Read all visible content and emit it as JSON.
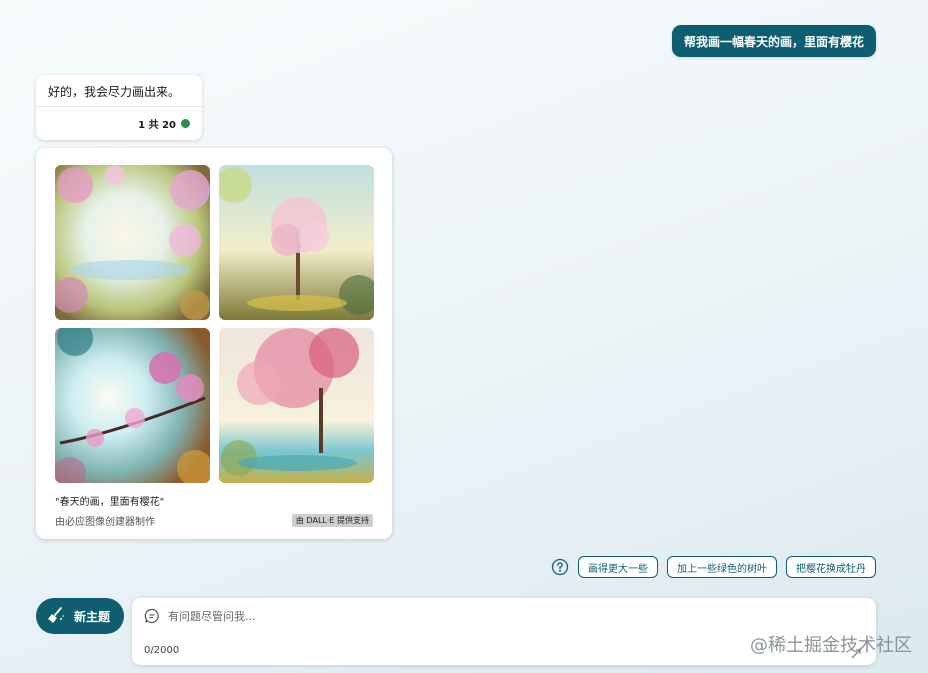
{
  "conversation": {
    "user_message": "帮我画一幅春天的画，里面有樱花",
    "bot_message": "好的，我会尽力画出来。",
    "bot_count": "1 共 20"
  },
  "image_result": {
    "caption": "\"春天的画，里面有樱花\"",
    "maker": "由必应图像创建器制作",
    "badge": "由 DALL·E 提供支持",
    "images": [
      "image-1",
      "image-2",
      "image-3",
      "image-4"
    ]
  },
  "suggestions": {
    "icon": "question-bubble-icon",
    "items": [
      "画得更大一些",
      "加上一些绿色的树叶",
      "把樱花换成牡丹"
    ]
  },
  "composer": {
    "new_topic_label": "新主题",
    "new_topic_icon": "broom-icon",
    "placeholder": "有问题尽管问我...",
    "char_count": "0/2000"
  },
  "watermark": "@稀土掘金技术社区",
  "colors": {
    "accent": "#0e5e70",
    "status_green": "#2e8b4f"
  }
}
